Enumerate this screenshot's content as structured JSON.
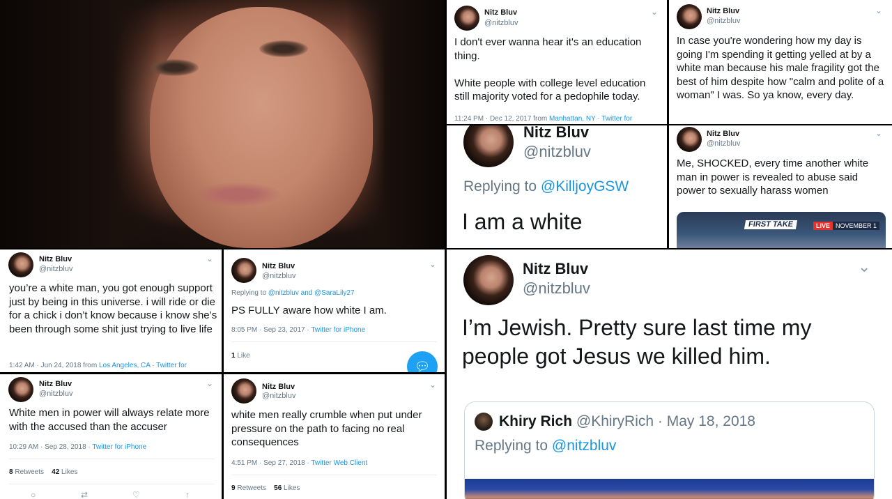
{
  "tweets": {
    "t1": {
      "name": "Nitz Bluv",
      "handle": "@nitzbluv",
      "text": "I don't ever wanna hear it's an education thing.\n\nWhite people with college level education still majority voted for a pedophile today.",
      "time": "11:24 PM · Dec 12, 2017 from ",
      "location": "Manhattan, NY",
      "sep": " · ",
      "client": "Twitter for"
    },
    "t2": {
      "name": "Nitz Bluv",
      "handle": "@nitzbluv",
      "text": "In case you're wondering how my day is going I'm spending it getting yelled at by a white man because his male fragility got the best of him despite how \"calm and polite of a woman\" I was. So ya know, every day."
    },
    "t3": {
      "name": "Nitz Bluv",
      "handle": "@nitzbluv",
      "replying_prefix": "Replying to ",
      "replying_to": "@KilljoyGSW",
      "text": "I am a white"
    },
    "t4": {
      "name": "Nitz Bluv",
      "handle": "@nitzbluv",
      "text": "Me, SHOCKED, every time another white man in power is revealed to abuse said power to sexually harass women",
      "media_tag1": "FIRST TAKE",
      "media_tag2": "LIVE",
      "media_tag3": "NOVEMBER 1"
    },
    "t5": {
      "name": "Nitz Bluv",
      "handle": "@nitzbluv",
      "text": "you’re a white man, you got enough support just by being in this universe. i will ride or die for a chick i don’t know because i know she’s been through some shit just trying to live life",
      "time": "1:42 AM · Jun 24, 2018 from ",
      "location": "Los Angeles, CA",
      "sep": " · ",
      "client": "Twitter for"
    },
    "t6": {
      "name": "Nitz Bluv",
      "handle": "@nitzbluv",
      "replying_prefix": "Replying to ",
      "replying_to": "@nitzbluv and @SaraLily27",
      "text": "PS FULLY aware how white I am.",
      "time": "8:05 PM · Sep 23, 2017 · ",
      "client": "Twitter for iPhone",
      "likes_count": "1",
      "likes_label": " Like"
    },
    "t7": {
      "name": "Nitz Bluv",
      "handle": "@nitzbluv",
      "text": "White men in power will always relate more with the accused than the accuser",
      "time": "10:29 AM · Sep 28, 2018 · ",
      "client": "Twitter for iPhone",
      "retweets_count": "8",
      "retweets_label": " Retweets",
      "likes_count": "42",
      "likes_label": " Likes"
    },
    "t8": {
      "name": "Nitz Bluv",
      "handle": "@nitzbluv",
      "text": "white men really crumble when put under pressure on the path to facing no real consequences",
      "time": "4:51 PM · Sep 27, 2018 · ",
      "client": "Twitter Web Client",
      "retweets_count": "9",
      "retweets_label": " Retweets",
      "likes_count": "56",
      "likes_label": " Likes"
    },
    "t9": {
      "name": "Nitz Bluv",
      "handle": "@nitzbluv",
      "text": "I’m Jewish. Pretty sure last time my people got Jesus we killed him.",
      "quote": {
        "name": "Khiry Rich",
        "handle": "@KhiryRich",
        "date": " · May 18, 2018",
        "replying_prefix": "Replying to ",
        "replying_to": "@nitzbluv"
      }
    }
  },
  "icons": {
    "chevron": "chevron-down-icon",
    "compose": "compose-reply-icon"
  },
  "colors": {
    "link": "#1b95e0",
    "muted": "#657786",
    "text": "#14171a",
    "fab": "#1da1f2"
  }
}
